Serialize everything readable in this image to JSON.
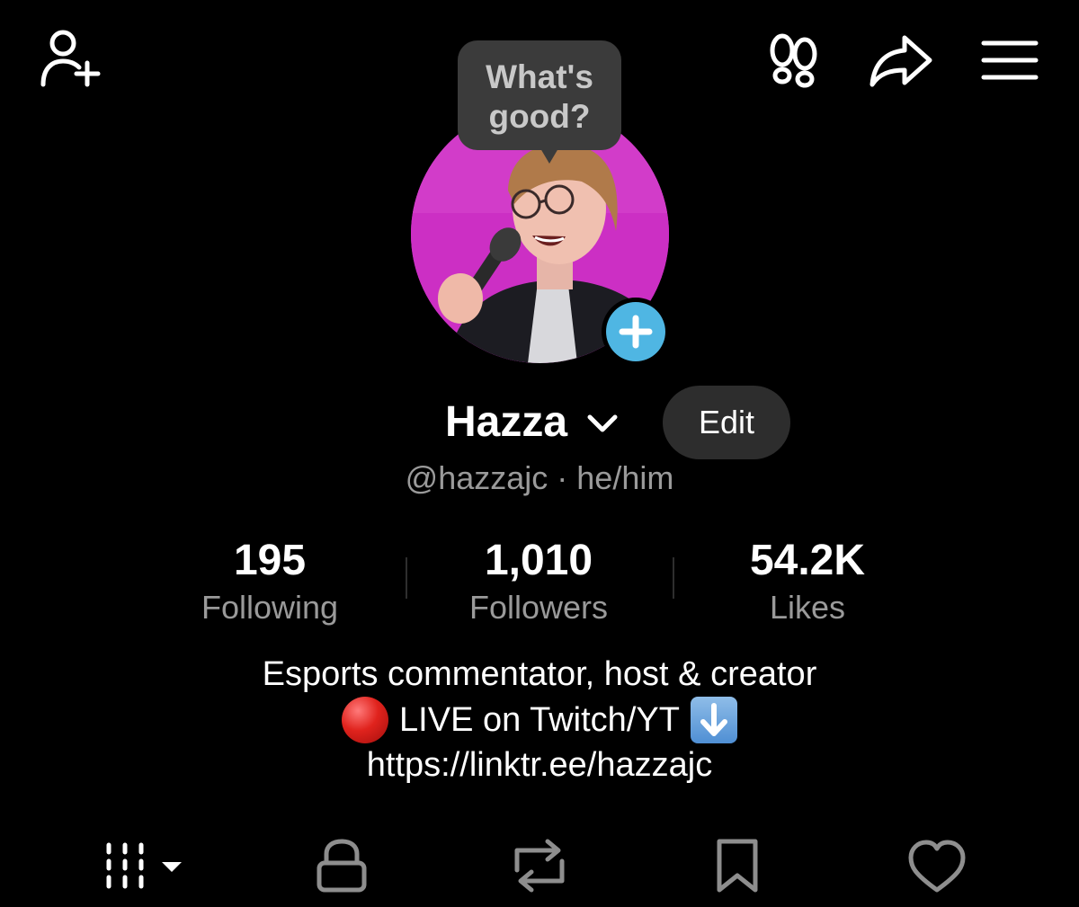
{
  "topbar": {
    "add_friend_icon": "person-plus-icon",
    "footprints_icon": "footprints-icon",
    "share_icon": "share-arrow-icon",
    "menu_icon": "hamburger-menu-icon"
  },
  "note_bubble": {
    "line1": "What's",
    "line2": "good?"
  },
  "profile": {
    "display_name": "Hazza",
    "edit_label": "Edit",
    "handle_text": "@hazzajc · he/him"
  },
  "stats": [
    {
      "value": "195",
      "label": "Following"
    },
    {
      "value": "1,010",
      "label": "Followers"
    },
    {
      "value": "54.2K",
      "label": "Likes"
    }
  ],
  "bio": {
    "line1": "Esports commentator, host & creator",
    "line2": "LIVE on Twitch/YT",
    "link": "https://linktr.ee/hazzajc"
  },
  "tabs": [
    {
      "icon": "grid-videos-icon"
    },
    {
      "icon": "lock-icon"
    },
    {
      "icon": "repost-icon"
    },
    {
      "icon": "bookmark-icon"
    },
    {
      "icon": "heart-icon"
    }
  ],
  "colors": {
    "background": "#000000",
    "accent_blue": "#4fb6e3",
    "avatar_bg": "#cc2fc4",
    "muted_text": "#9a9a9a"
  }
}
